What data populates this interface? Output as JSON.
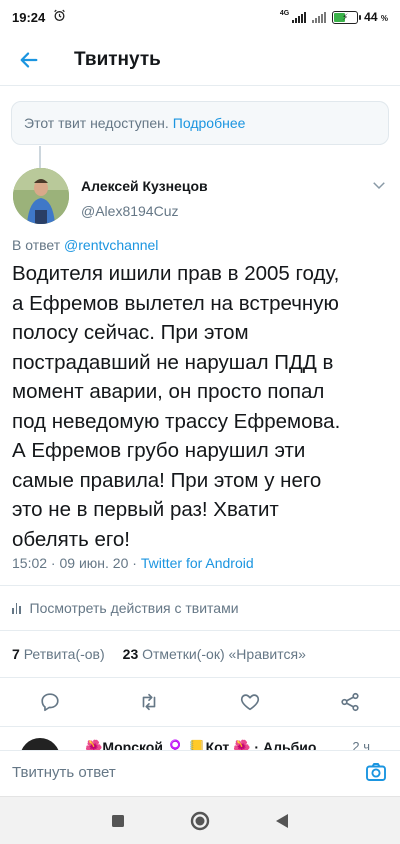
{
  "status_bar": {
    "time": "19:24",
    "network": "4G",
    "battery_percent": "44",
    "battery_unit": "%"
  },
  "header": {
    "title": "Твитнуть"
  },
  "unavailable": {
    "text": "Этот твит недоступен.",
    "link": "Подробнее"
  },
  "tweet": {
    "author_name": "Алексей Кузнецов",
    "author_handle": "@Alex8194Cuz",
    "reply_prefix": "В ответ",
    "reply_mention": "@rentvchannel",
    "lines": [
      "Водителя ишили прав в 2005 году,",
      "а Ефремов вылетел на встречную",
      "полосу сейчас. При этом",
      "пострадавший не нарушал ПДД в",
      "момент аварии, он просто попал",
      "под неведомую трассу Ефремова.",
      "А Ефремов грубо нарушил эти",
      "самые правила! При этом у него",
      "это не в первый раз! Хватит",
      "обелять его!"
    ],
    "time": "15:02",
    "date": "09 июн. 20",
    "source": "Twitter for Android"
  },
  "activity": {
    "label": "Посмотреть действия с твитами"
  },
  "stats": {
    "retweets_count": "7",
    "retweets_label": "Ретвита(-ов)",
    "likes_count": "23",
    "likes_label": "Отметки(-ок) «Нравится»"
  },
  "next_reply": {
    "text": "🌺Морской ♀️ 📒Кот 🌺 · Альбио",
    "time": "2 ч"
  },
  "composer": {
    "placeholder": "Твитнуть ответ"
  },
  "colors": {
    "accent": "#1b95e0",
    "secondary_text": "#657786",
    "primary_text": "#14171a",
    "border": "#e6ecf0"
  }
}
